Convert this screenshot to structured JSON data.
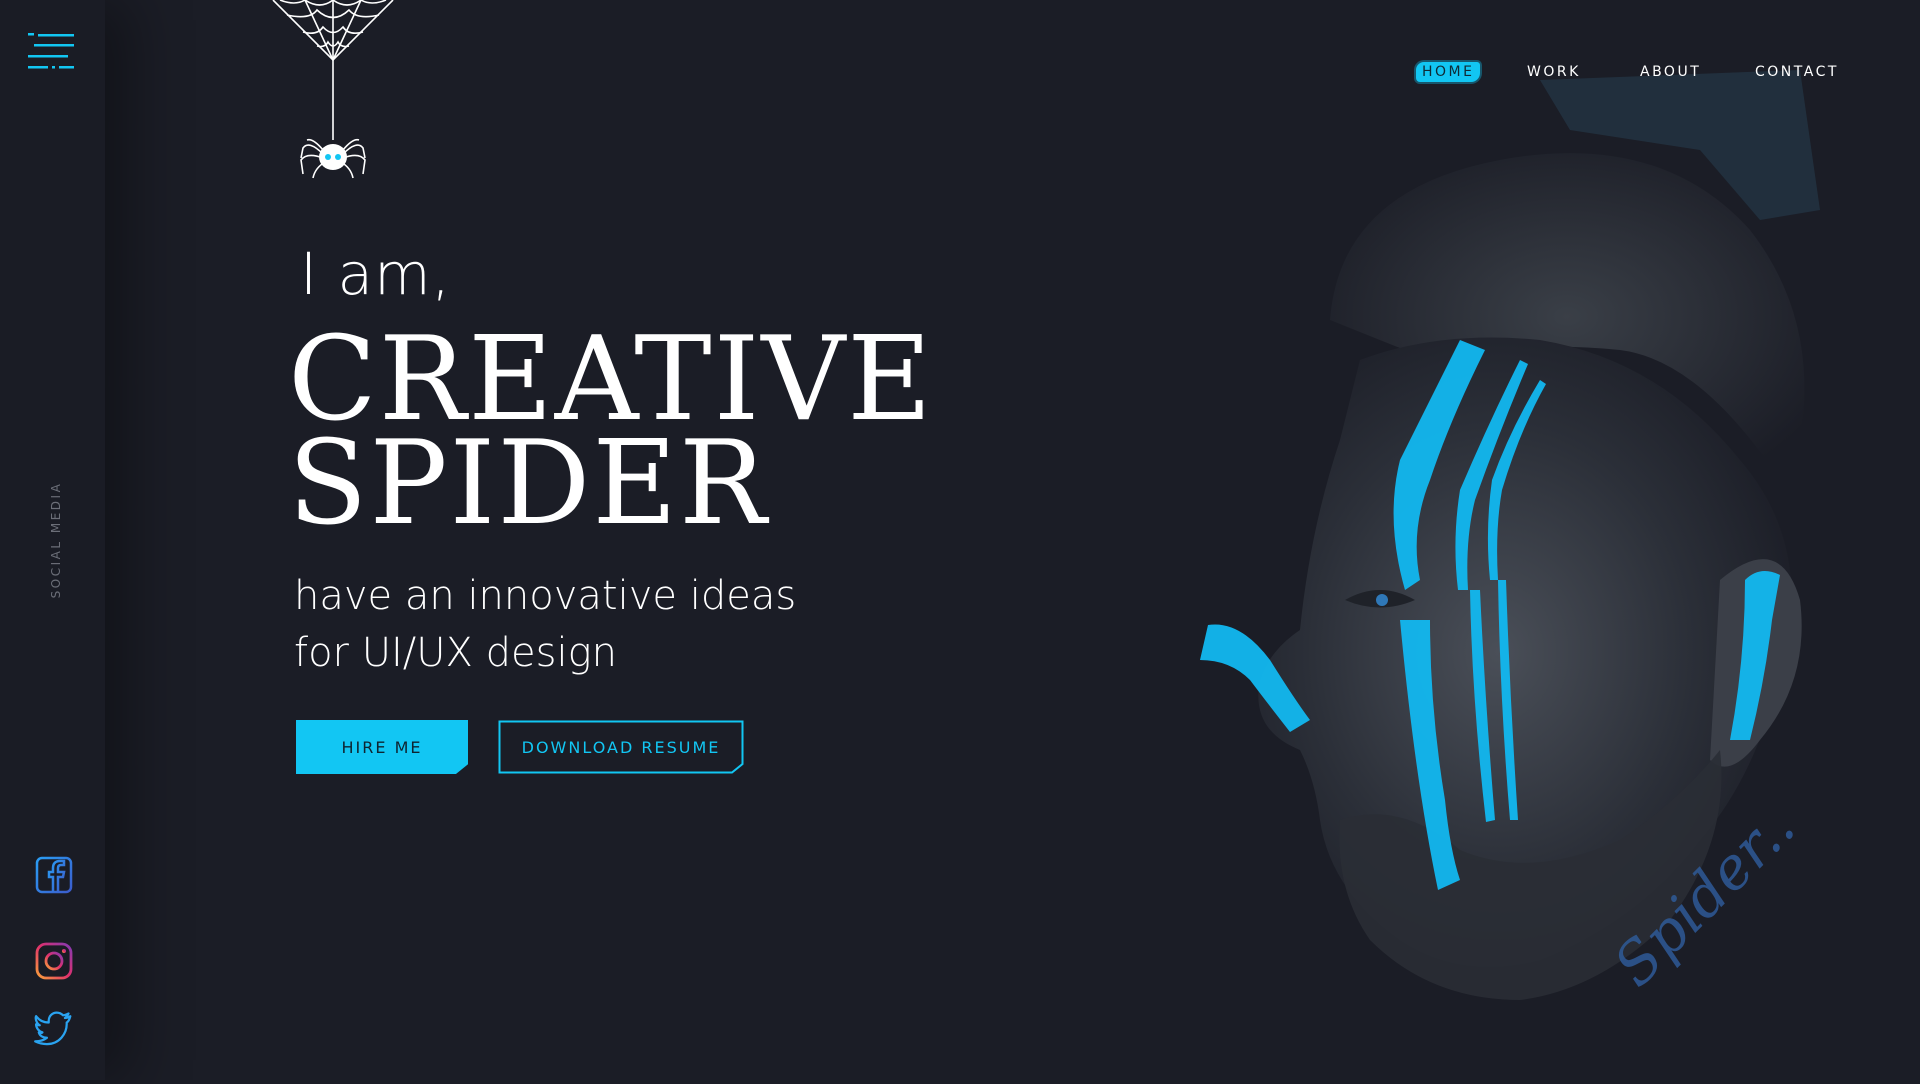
{
  "nav": {
    "items": [
      {
        "label": "HOME",
        "active": true
      },
      {
        "label": "WORK"
      },
      {
        "label": "ABOUT"
      },
      {
        "label": "CONTACT"
      }
    ]
  },
  "sidebar": {
    "social_label": "SOCIAL MEDIA",
    "social_icons": [
      "facebook-icon",
      "instagram-icon",
      "twitter-icon"
    ]
  },
  "hero": {
    "intro": "I am,",
    "title_line1": "CREATIVE",
    "title_line2": "SPIDER",
    "subtitle_line1": "have an innovative ideas",
    "subtitle_line2": "for UI/UX design"
  },
  "buttons": {
    "hire": "HIRE ME",
    "resume": "DOWNLOAD RESUME"
  },
  "portrait": {
    "signature": "Spider.."
  },
  "colors": {
    "background": "#1b1d26",
    "sidebar": "#1a1c25",
    "accent": "#12c6f3",
    "text": "#ffffff",
    "muted": "#6b6e78"
  }
}
